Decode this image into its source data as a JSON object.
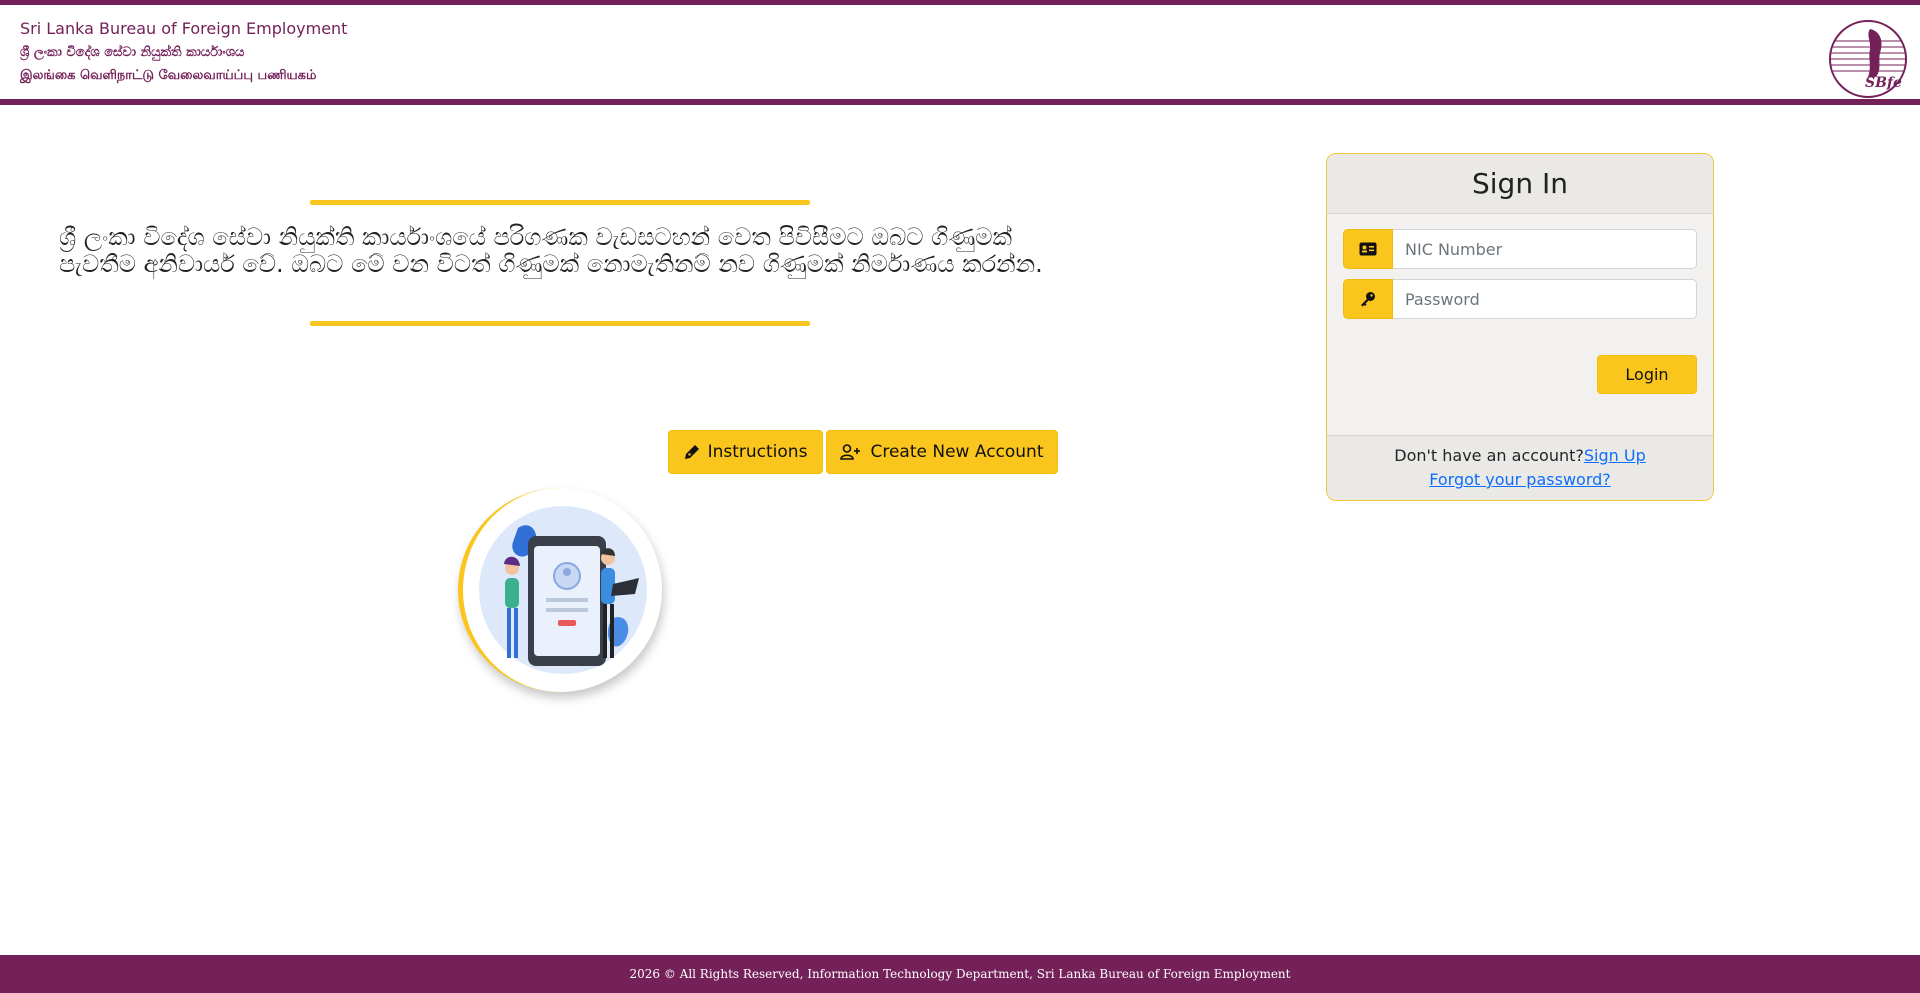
{
  "header": {
    "org_en": "Sri Lanka Bureau of Foreign Employment",
    "org_si": "ශ්‍රී ලංකා විදේශ සේවා නියුක්ති කාර්යාංශය",
    "org_ta": "இலங்கை வெளிநாட்டு வேலைவாய்ப்பு பணியகம்",
    "logo_text": "SLBFE",
    "brand_color": "#74215a"
  },
  "main": {
    "intro_text": "ශ්‍රී ලංකා විදේශ සේවා නියුක්ති කාර්යාංශයේ පරිගණක වැඩසටහන් වෙත පිවිසීමට ඔබට ගිණුමක් පැවතීම අනිවාර්ය වේ. ඔබට මේ වන විටත් ගිණුමක් නොමැතිනම් නව ගිණුමක් නිර්මාණය කරන්න.",
    "instructions_label": "Instructions",
    "create_account_label": "Create New Account",
    "accent_color": "#fac51d"
  },
  "signin": {
    "title": "Sign In",
    "nic_placeholder": "NIC Number",
    "password_placeholder": "Password",
    "login_label": "Login",
    "no_account_text": "Don't have an account?",
    "signup_link": "Sign Up",
    "forgot_link": "Forgot your password?"
  },
  "footer": {
    "text": "2026 © All Rights Reserved, Information Technology Department, Sri Lanka Bureau of Foreign Employment"
  },
  "icons": {
    "instructions": "pen-nib-icon",
    "create_account": "user-plus-icon",
    "nic": "id-card-icon",
    "password": "key-icon"
  }
}
